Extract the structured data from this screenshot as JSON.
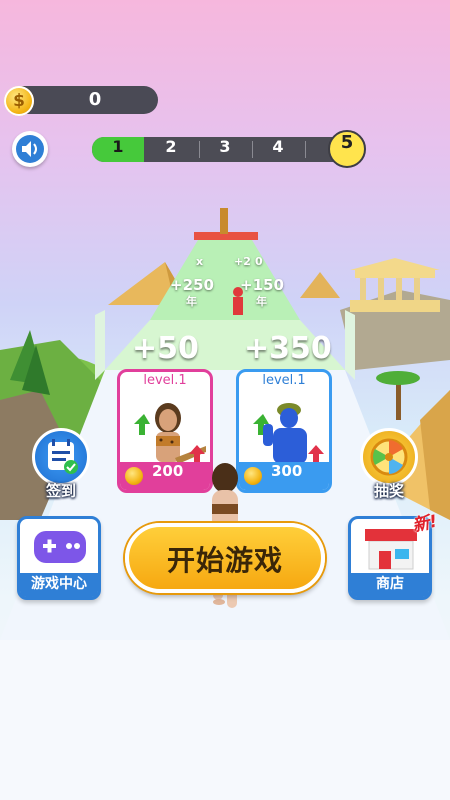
{
  "hud": {
    "coins": "0",
    "sound_icon": "speaker-icon",
    "levels": [
      "1",
      "2",
      "3",
      "4"
    ],
    "final_level": "5",
    "current_level": 1
  },
  "track": {
    "gates": [
      "+250",
      "+150"
    ],
    "gate_sub": [
      "年",
      "年"
    ],
    "small_marks": [
      "x",
      "+2",
      "0"
    ]
  },
  "offers": {
    "left_bonus": "+50",
    "right_bonus": "+350",
    "cards": [
      {
        "level": "level.1",
        "price": "200",
        "color": "#e13f9b"
      },
      {
        "level": "level.1",
        "price": "300",
        "color": "#3a9bf0"
      }
    ]
  },
  "buttons": {
    "sign_in": "签到",
    "lottery": "抽奖",
    "game_center": "游戏中心",
    "start": "开始游戏",
    "shop": "商店",
    "new_badge": "新!"
  },
  "colors": {
    "accent": "#f6a811",
    "level_active": "#46c93b",
    "tile_blue": "#2f7fd6"
  }
}
